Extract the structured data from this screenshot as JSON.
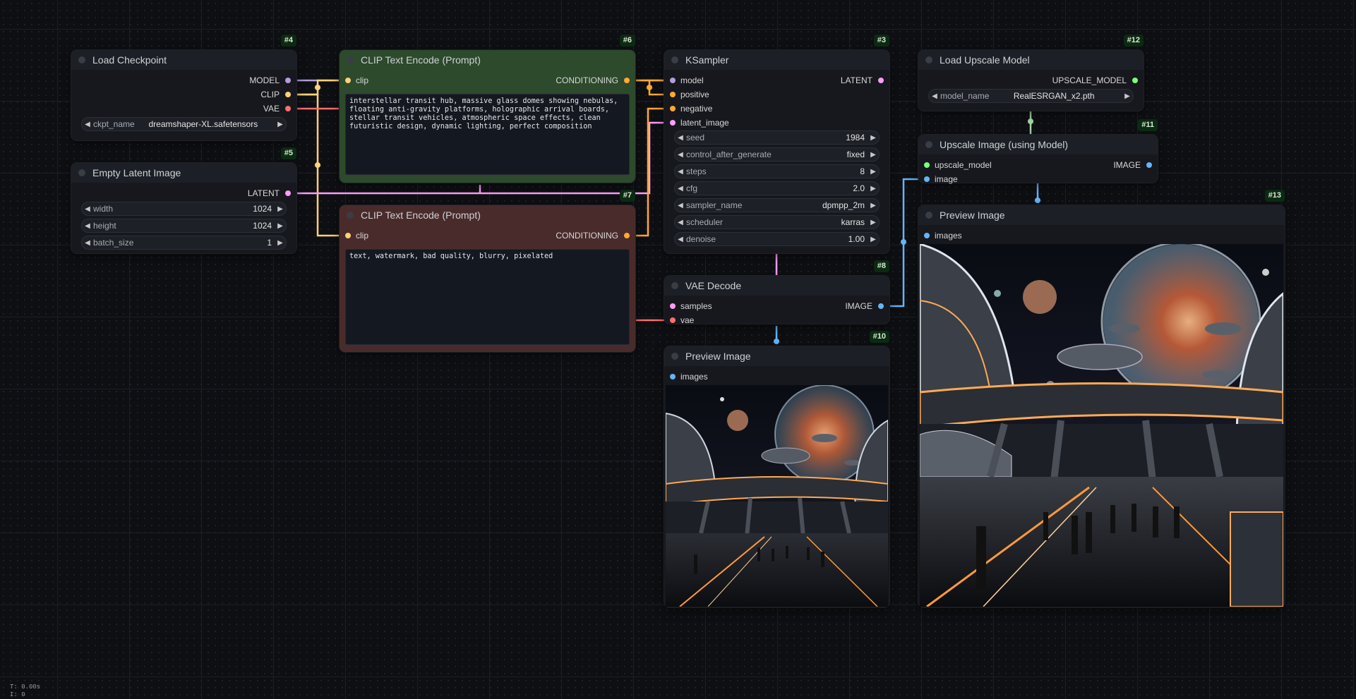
{
  "colors": {
    "model": "#b39ddb",
    "clip": "#ffd179",
    "vae": "#ff6e6e",
    "latent": "#ff9cf9",
    "conditioning": "#ffa931",
    "image": "#64b5f6",
    "upscale_model": "#7cff7c"
  },
  "nodes": {
    "load_checkpoint": {
      "id": "#4",
      "title": "Load Checkpoint",
      "outputs": [
        "MODEL",
        "CLIP",
        "VAE"
      ],
      "ckpt_label": "ckpt_name",
      "ckpt_value": "dreamshaper-XL.safetensors"
    },
    "empty_latent": {
      "id": "#5",
      "title": "Empty Latent Image",
      "output": "LATENT",
      "width_label": "width",
      "width_value": "1024",
      "height_label": "height",
      "height_value": "1024",
      "batch_label": "batch_size",
      "batch_value": "1"
    },
    "clip_pos": {
      "id": "#6",
      "title": "CLIP Text Encode (Prompt)",
      "input": "clip",
      "output": "CONDITIONING",
      "text": "interstellar transit hub, massive glass domes showing nebulas,\nfloating anti-gravity platforms, holographic arrival boards,\nstellar transit vehicles, atmospheric space effects, clean\nfuturistic design, dynamic lighting, perfect composition"
    },
    "clip_neg": {
      "id": "#7",
      "title": "CLIP Text Encode (Prompt)",
      "input": "clip",
      "output": "CONDITIONING",
      "text": "text, watermark, bad quality, blurry, pixelated"
    },
    "ksampler": {
      "id": "#3",
      "title": "KSampler",
      "inputs": [
        "model",
        "positive",
        "negative",
        "latent_image"
      ],
      "output": "LATENT",
      "widgets": [
        {
          "label": "seed",
          "value": "1984"
        },
        {
          "label": "control_after_generate",
          "value": "fixed"
        },
        {
          "label": "steps",
          "value": "8"
        },
        {
          "label": "cfg",
          "value": "2.0"
        },
        {
          "label": "sampler_name",
          "value": "dpmpp_2m"
        },
        {
          "label": "scheduler",
          "value": "karras"
        },
        {
          "label": "denoise",
          "value": "1.00"
        }
      ]
    },
    "vae_decode": {
      "id": "#8",
      "title": "VAE Decode",
      "inputs": [
        "samples",
        "vae"
      ],
      "output": "IMAGE"
    },
    "preview_small": {
      "id": "#10",
      "title": "Preview Image",
      "input": "images"
    },
    "load_upscale": {
      "id": "#12",
      "title": "Load Upscale Model",
      "output": "UPSCALE_MODEL",
      "model_label": "model_name",
      "model_value": "RealESRGAN_x2.pth"
    },
    "upscale_image": {
      "id": "#11",
      "title": "Upscale Image (using Model)",
      "inputs": [
        "upscale_model",
        "image"
      ],
      "output": "IMAGE"
    },
    "preview_large": {
      "id": "#13",
      "title": "Preview Image",
      "input": "images"
    }
  },
  "status": {
    "time": "T: 0.00s",
    "line2": "I: 0"
  }
}
